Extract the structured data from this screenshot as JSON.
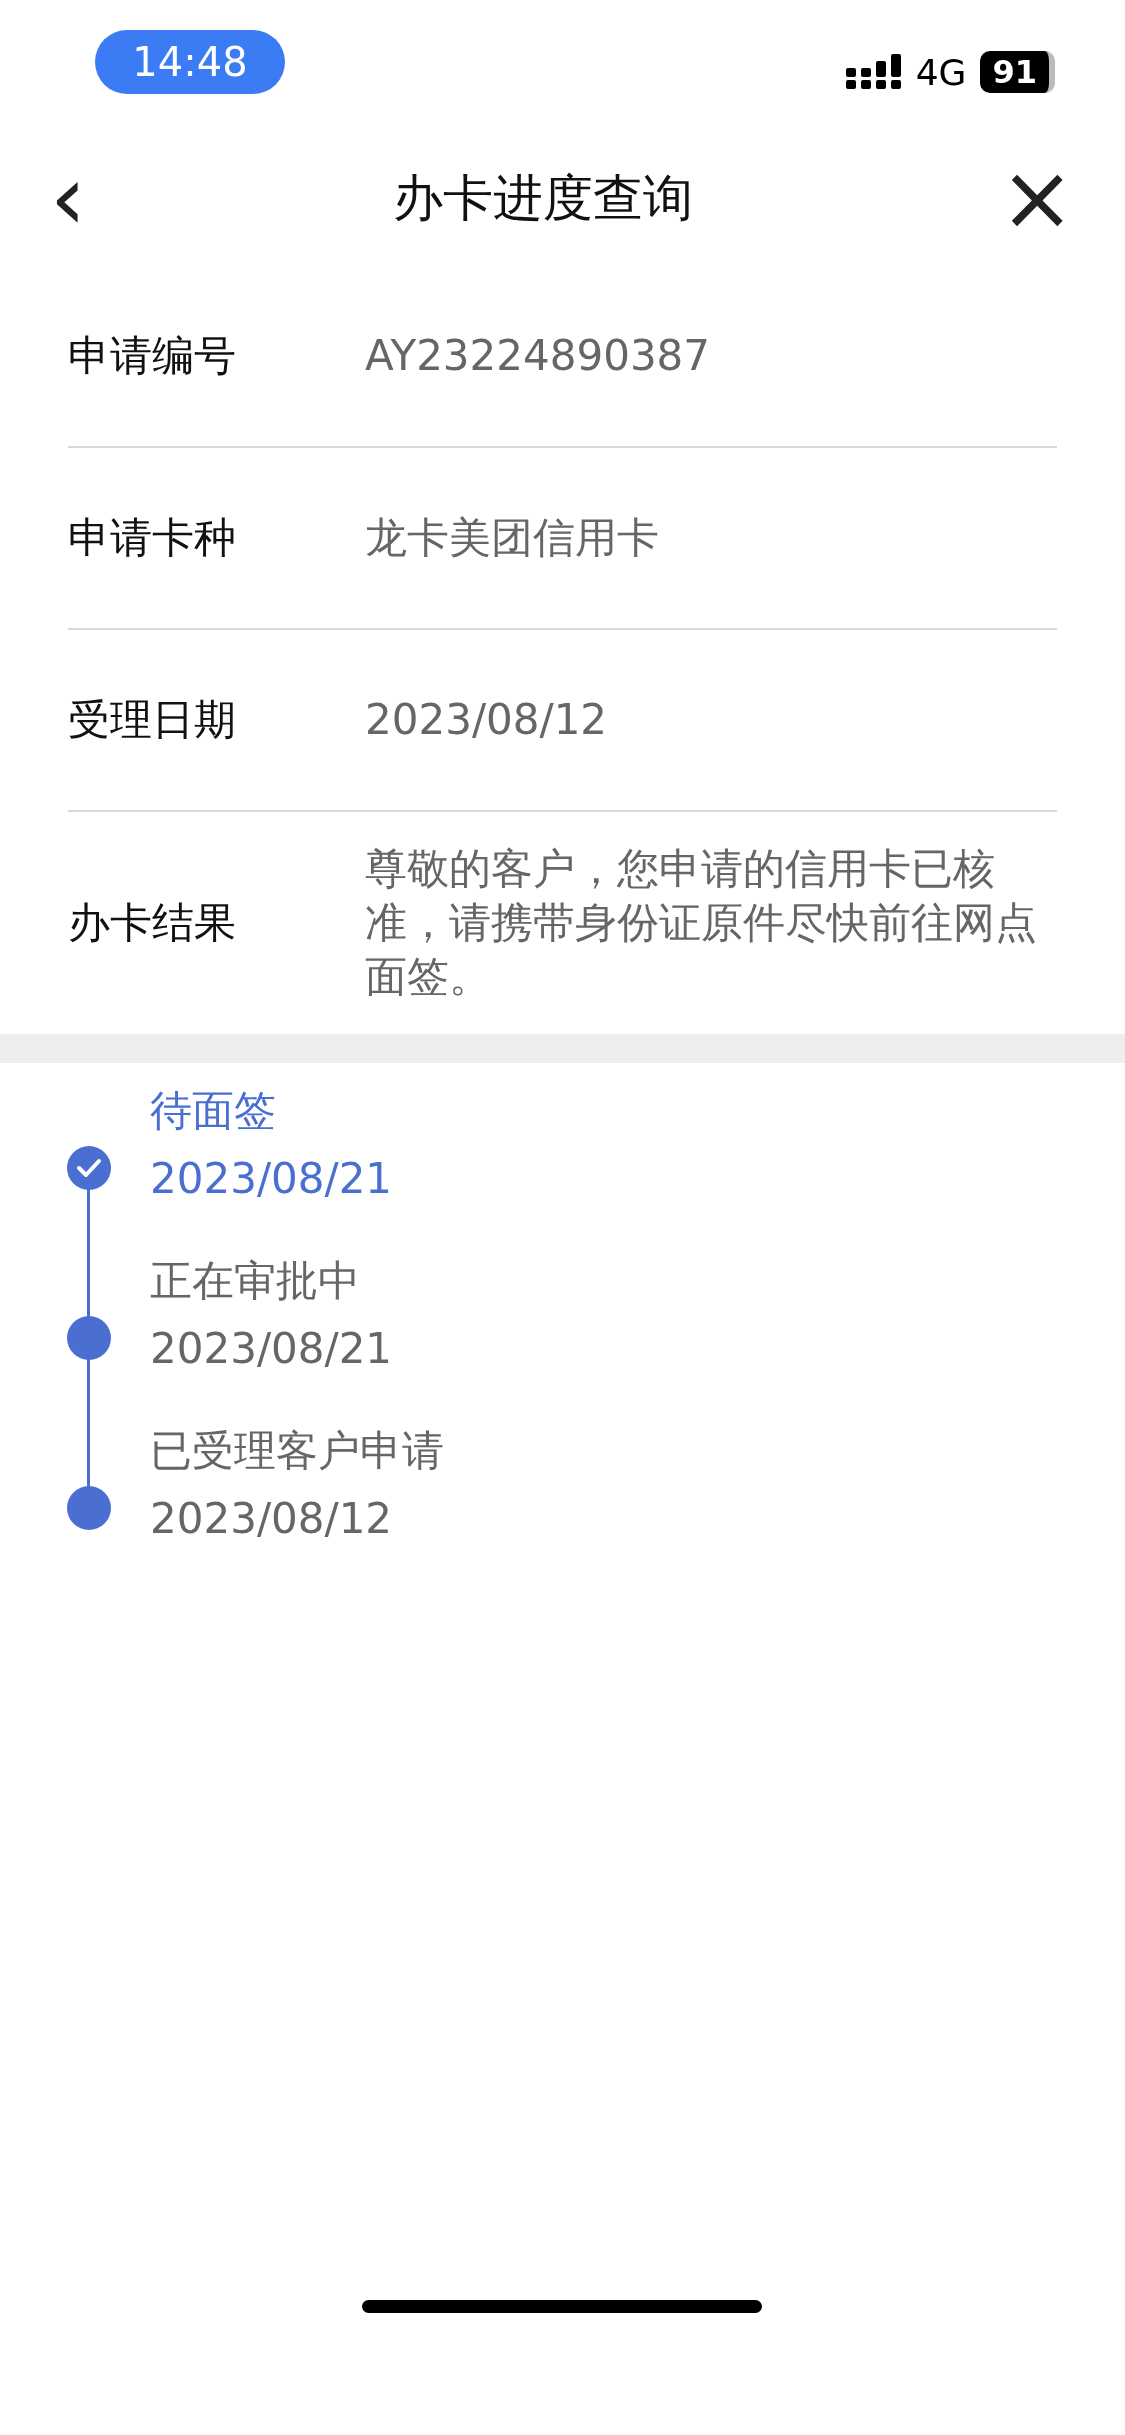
{
  "status_bar": {
    "time": "14:48",
    "network": "4G",
    "battery": "91"
  },
  "nav": {
    "back": "‹",
    "title": "办卡进度查询",
    "close": "×"
  },
  "fields": [
    {
      "label": "申请编号",
      "value": "AY23224890387"
    },
    {
      "label": "申请卡种",
      "value": "龙卡美团信用卡"
    },
    {
      "label": "受理日期",
      "value": "2023/08/12"
    },
    {
      "label": "办卡结果",
      "value": "尊敬的客户，您申请的信用卡已核准，请携带身份证原件尽快前往网点面签。"
    }
  ],
  "timeline": [
    {
      "title": "待面签",
      "date": "2023/08/21",
      "selected": true
    },
    {
      "title": "正在审批中",
      "date": "2023/08/21",
      "selected": false
    },
    {
      "title": "已受理客户申请",
      "date": "2023/08/12",
      "selected": false
    }
  ]
}
